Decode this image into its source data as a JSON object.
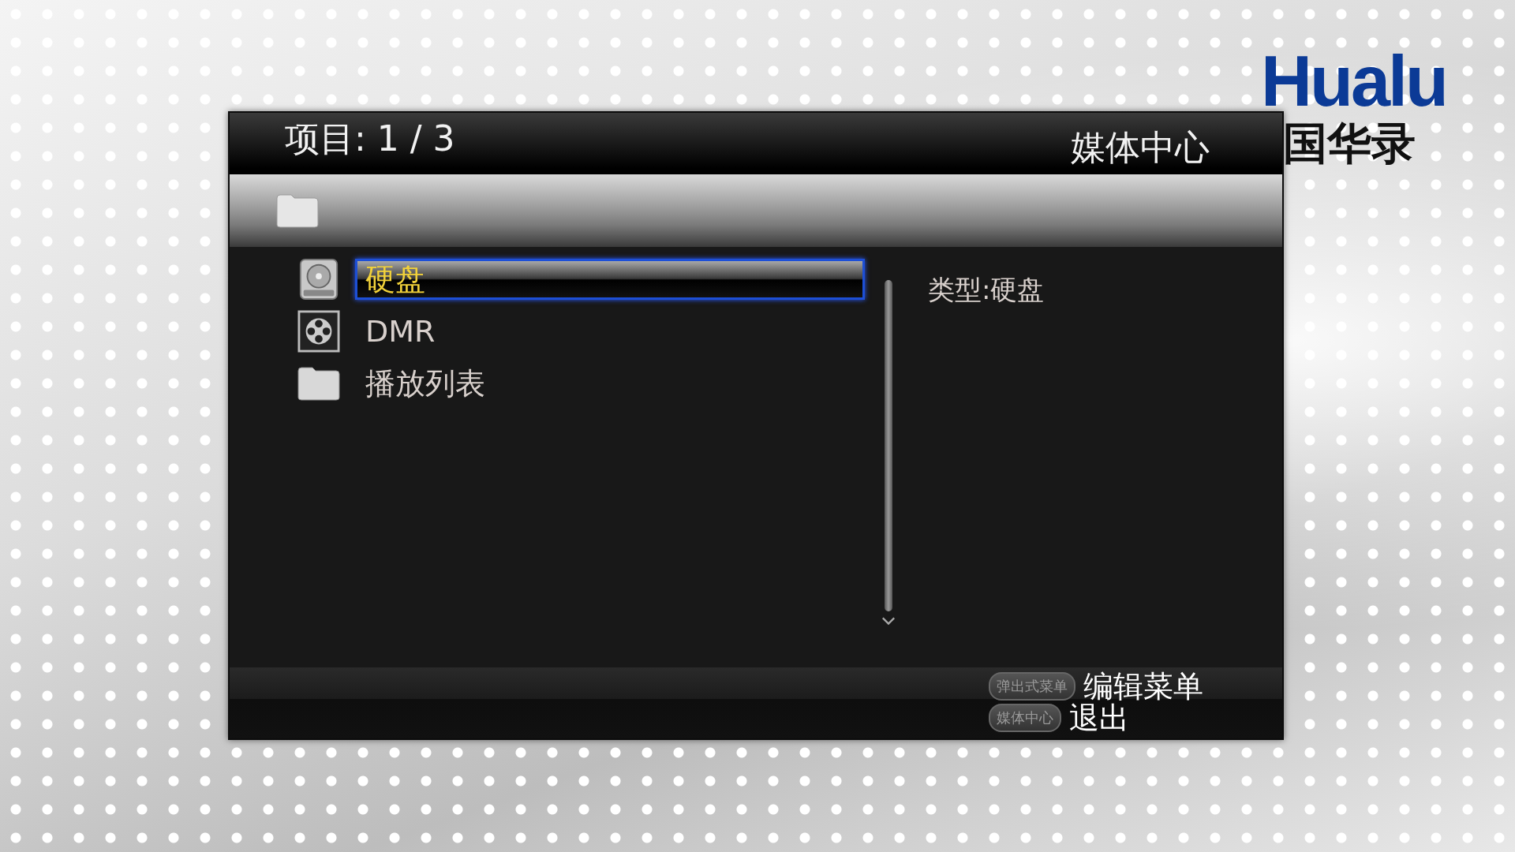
{
  "logo": {
    "brand": "Hualu",
    "name": "国华录"
  },
  "header": {
    "counter": "项目: 1 / 3",
    "title": "媒体中心"
  },
  "items": [
    {
      "kind": "disk",
      "label": "硬盘",
      "selected": true
    },
    {
      "kind": "dmr",
      "label": "DMR",
      "selected": false
    },
    {
      "kind": "folder",
      "label": "播放列表",
      "selected": false
    }
  ],
  "info": "类型:硬盘",
  "hints": [
    {
      "key": "弹出式菜单",
      "action": "编辑菜单"
    },
    {
      "key": "媒体中心",
      "action": "退出"
    }
  ]
}
